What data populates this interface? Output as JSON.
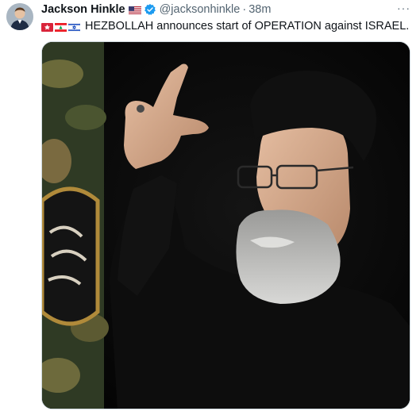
{
  "author": {
    "name": "Jackson Hinkle",
    "handle": "@jacksonhinkle",
    "separator": "·",
    "time": "38m"
  },
  "more_label": "···",
  "tweet": {
    "flags": [
      "flag-emoji-1",
      "flag-lebanon",
      "flag-israel"
    ],
    "text": "HEZBOLLAH announces start of OPERATION against ISRAEL."
  },
  "media": {
    "kind": "photo",
    "description_icon": "photo"
  },
  "colors": {
    "text_primary": "#0f1419",
    "text_secondary": "#536471",
    "verified_blue": "#1d9bf0",
    "border": "#cfd9de"
  }
}
